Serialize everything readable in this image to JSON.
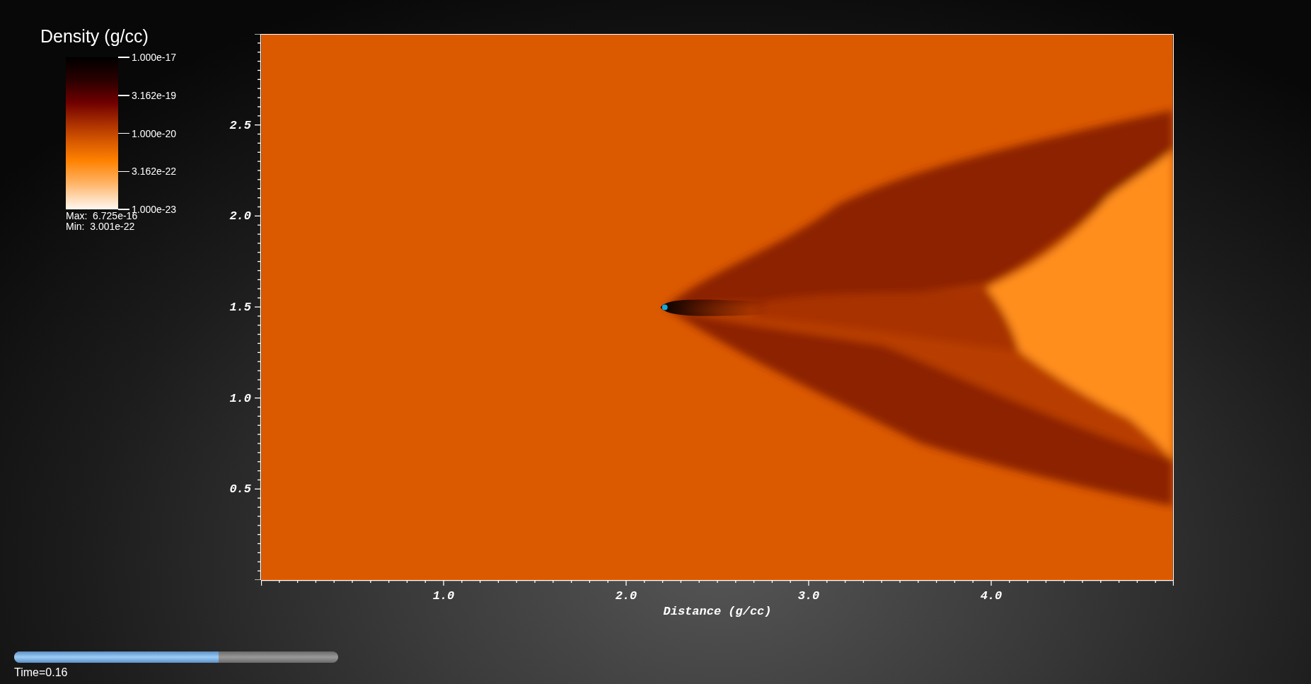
{
  "legend": {
    "title": "Density (g/cc)",
    "labels": [
      "1.000e-17",
      "3.162e-19",
      "1.000e-20",
      "3.162e-22",
      "1.000e-23"
    ],
    "max": "Max:  6.725e-16",
    "min": "Min:  3.001e-22"
  },
  "plot": {
    "y_axis": {
      "ticks": [
        "2.5",
        "2.0",
        "1.5",
        "1.0",
        "0.5"
      ]
    },
    "x_axis": {
      "ticks": [
        "1.0",
        "2.0",
        "3.0",
        "4.0"
      ],
      "title": "Distance (g/cc)"
    }
  },
  "time_slider": {
    "level": 0.63,
    "label": "Time=0.16"
  }
}
